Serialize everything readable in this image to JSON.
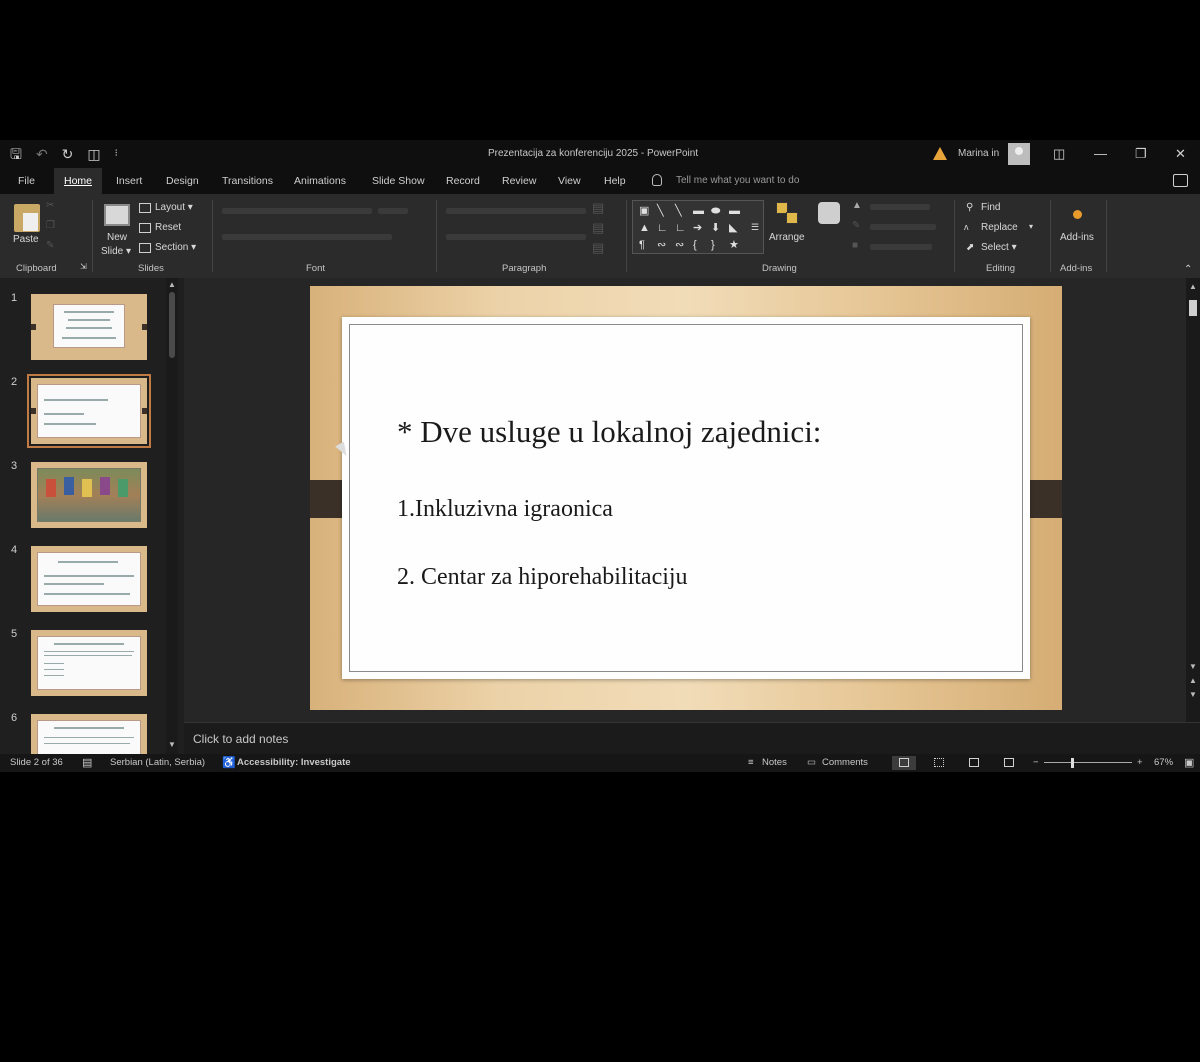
{
  "title_bar": {
    "quick_access": [
      "save-icon",
      "undo-icon",
      "redo-icon",
      "present-icon",
      "customize-icon"
    ],
    "document_title": "Prezentacija za konferenciju 2025 - PowerPoint",
    "user_name": "Marina in",
    "window_controls": [
      "ribbon-display-icon",
      "minimize-icon",
      "restore-icon",
      "close-icon"
    ]
  },
  "tabs": [
    {
      "label": "File"
    },
    {
      "label": "Home",
      "active": true
    },
    {
      "label": "Insert"
    },
    {
      "label": "Design"
    },
    {
      "label": "Transitions"
    },
    {
      "label": "Animations"
    },
    {
      "label": "Slide Show"
    },
    {
      "label": "Record"
    },
    {
      "label": "Review"
    },
    {
      "label": "View"
    },
    {
      "label": "Help"
    }
  ],
  "tell_me": "Tell me what you want to do",
  "ribbon": {
    "clipboard": {
      "paste": "Paste",
      "label": "Clipboard"
    },
    "slides": {
      "new_slide": "New",
      "new_slide_2": "Slide ▾",
      "layout": "Layout ▾",
      "reset": "Reset",
      "section": "Section ▾",
      "label": "Slides"
    },
    "font": {
      "label": "Font"
    },
    "paragraph": {
      "label": "Paragraph"
    },
    "drawing": {
      "arrange": "Arrange",
      "label": "Drawing"
    },
    "editing": {
      "find": "Find",
      "replace": "Replace",
      "select": "Select ▾",
      "label": "Editing"
    },
    "addins": {
      "button": "Add-ins",
      "label": "Add-ins"
    }
  },
  "thumbnails": [
    {
      "num": "1",
      "kind": "title"
    },
    {
      "num": "2",
      "kind": "list",
      "selected": true
    },
    {
      "num": "3",
      "kind": "photo"
    },
    {
      "num": "4",
      "kind": "list"
    },
    {
      "num": "5",
      "kind": "text"
    },
    {
      "num": "6",
      "kind": "text"
    }
  ],
  "slide": {
    "title": "* Dve usluge u lokalnoj zajednici:",
    "item1": "1.Inkluzivna igraonica",
    "item2": "2. Centar za hiporehabilitaciju"
  },
  "notes_placeholder": "Click to add notes",
  "status": {
    "slide_count": "Slide 2 of 36",
    "language": "Serbian (Latin, Serbia)",
    "accessibility": "Accessibility: Investigate",
    "notes": "Notes",
    "comments": "Comments",
    "zoom": "67%"
  },
  "colors": {
    "accent_selected_thumb": "#c07a44",
    "slide_band": "#3b3028",
    "warning": "#e8a53a"
  }
}
